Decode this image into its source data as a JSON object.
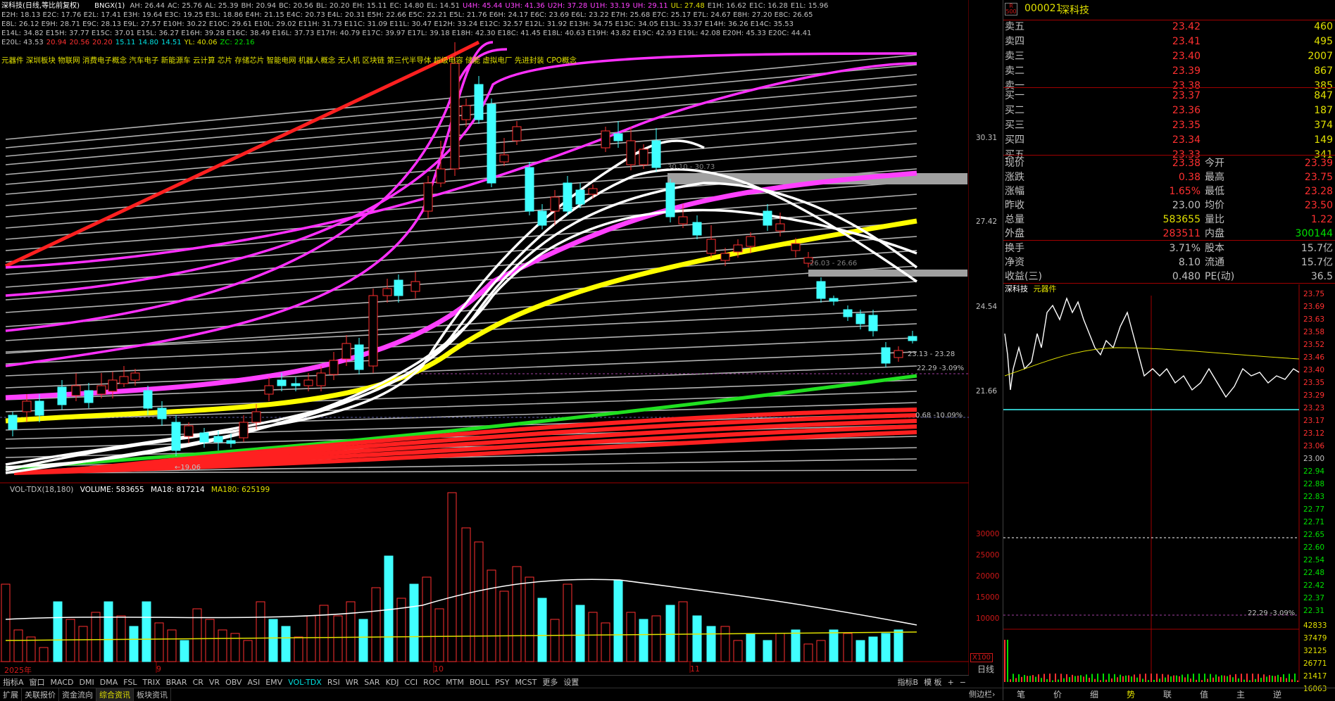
{
  "header": {
    "stock_name": "深科技",
    "chart_mode": "(日线,等比前复权)",
    "indicator_name": "BNGX(1)",
    "indicators_line1": [
      {
        "t": "AH: 26.44",
        "c": "#c0c0c0"
      },
      {
        "t": "AC: 25.76",
        "c": "#c0c0c0"
      },
      {
        "t": "AL: 25.39",
        "c": "#c0c0c0"
      },
      {
        "t": "BH: 20.94",
        "c": "#c0c0c0"
      },
      {
        "t": "BC: 20.56",
        "c": "#c0c0c0"
      },
      {
        "t": "BL: 20.20",
        "c": "#c0c0c0"
      },
      {
        "t": "EH: 15.11",
        "c": "#c0c0c0"
      },
      {
        "t": "EC: 14.80",
        "c": "#c0c0c0"
      },
      {
        "t": "EL: 14.51",
        "c": "#c0c0c0"
      },
      {
        "t": "U4H: 45.44",
        "c": "#ff40ff"
      },
      {
        "t": "U3H: 41.36",
        "c": "#ff40ff"
      },
      {
        "t": "U2H: 37.28",
        "c": "#ff40ff"
      },
      {
        "t": "U1H: 33.19",
        "c": "#ff40ff"
      },
      {
        "t": "UH: 29.11",
        "c": "#ff40ff"
      },
      {
        "t": "UL: 27.48",
        "c": "#e0e000"
      },
      {
        "t": "E1H: 16.62",
        "c": "#c0c0c0"
      },
      {
        "t": "E1C: 16.28",
        "c": "#c0c0c0"
      },
      {
        "t": "E1L: 15.96",
        "c": "#c0c0c0"
      }
    ],
    "indicators_line2": "E2H: 18.13 E2C: 17.76 E2L: 17.41 E3H: 19.64 E3C: 19.25 E3L: 18.86 E4H: 21.15 E4C: 20.73 E4L: 20.31 E5H: 22.66 E5C: 22.21 E5L: 21.76 E6H: 24.17 E6C: 23.69 E6L: 23.22 E7H: 25.68 E7C: 25.17 E7L: 24.67 E8H: 27.20 E8C: 26.65",
    "indicators_line3": "E8L: 26.12 E9H: 28.71 E9C: 28.13 E9L: 27.57 E10H: 30.22 E10C: 29.61 E10L: 29.02 E11H: 31.73 E11C: 31.09 E11L: 30.47 E12H: 33.24 E12C: 32.57 E12L: 31.92 E13H: 34.75 E13C: 34.05 E13L: 33.37 E14H: 36.26 E14C: 35.53",
    "indicators_line4": "E14L: 34.82 E15H: 37.77 E15C: 37.01 E15L: 36.27 E16H: 39.28 E16C: 38.49 E16L: 37.73 E17H: 40.79 E17C: 39.97 E17L: 39.18 E18H: 42.30 E18C: 41.45 E18L: 40.63 E19H: 43.82 E19C: 42.93 E19L: 42.08 E20H: 45.33 E20C: 44.41",
    "indicators_line5": [
      {
        "t": "E20L: 43.53",
        "c": "#c0c0c0"
      },
      {
        "t": "20.94",
        "c": "#ff3030"
      },
      {
        "t": "20.56",
        "c": "#ff3030"
      },
      {
        "t": "20.20",
        "c": "#ff3030"
      },
      {
        "t": "15.11",
        "c": "#00e0e0"
      },
      {
        "t": "14.80",
        "c": "#00e0e0"
      },
      {
        "t": "14.51",
        "c": "#00e0e0"
      },
      {
        "t": "YL: 40.06",
        "c": "#e0e000"
      },
      {
        "t": "ZC: 22.16",
        "c": "#00e000"
      }
    ],
    "sectors": "元器件 深圳板块 物联网 消费电子概念 汽车电子 新能源车 云计算 芯片 存储芯片 智能电网 机器人概念 无人机 区块链 第三代半导体 超级电容 储能 虚拟电厂 先进封装 CPO概念"
  },
  "main_chart": {
    "y_ticks": [
      "30.31",
      "27.42",
      "24.54",
      "21.66"
    ],
    "annotations": [
      {
        "t": "30.10 - 30.73",
        "c": "#808080"
      },
      {
        "t": "26.03 - 26.66",
        "c": "#808080"
      },
      {
        "t": "23.13 - 23.28",
        "c": "#c0c0c0"
      },
      {
        "t": "22.29 -3.09%",
        "c": "#c0c0c0"
      },
      {
        "t": "0.68 -10.09%",
        "c": "#c0c0c0"
      },
      {
        "t": "←19.06",
        "c": "#c0c0c0"
      }
    ]
  },
  "volume": {
    "title": "VOL-TDX(18,180)",
    "volume_label": "VOLUME: 583655",
    "ma18_label": "MA18: 817214",
    "ma180_label": "MA180: 625199",
    "y_ticks": [
      "30000",
      "25000",
      "20000",
      "15000",
      "10000"
    ],
    "unit": "X100",
    "dates": [
      "2025年",
      "9",
      "10",
      "11"
    ]
  },
  "toolbar": [
    "指标A",
    "窗口",
    "MACD",
    "DMI",
    "DMA",
    "FSL",
    "TRIX",
    "BRAR",
    "CR",
    "VR",
    "OBV",
    "ASI",
    "EMV",
    "VOL-TDX",
    "RSI",
    "WR",
    "SAR",
    "KDJ",
    "CCI",
    "ROC",
    "MTM",
    "BOLL",
    "PSY",
    "MCST",
    "更多",
    "设置"
  ],
  "toolbar_right": [
    "指标B",
    "模 板",
    "+",
    "−"
  ],
  "bottombar": [
    "扩展",
    "关联报价",
    "资金流向",
    "综合资讯",
    "板块资讯"
  ],
  "bottombar_right": "侧边栏",
  "quote": {
    "code": "000021",
    "name": "深科技",
    "asks": [
      {
        "label": "卖五",
        "price": "23.42",
        "vol": "460"
      },
      {
        "label": "卖四",
        "price": "23.41",
        "vol": "495"
      },
      {
        "label": "卖三",
        "price": "23.40",
        "vol": "2007"
      },
      {
        "label": "卖二",
        "price": "23.39",
        "vol": "867"
      },
      {
        "label": "卖一",
        "price": "23.38",
        "vol": "385"
      }
    ],
    "bids": [
      {
        "label": "买一",
        "price": "23.37",
        "vol": "847"
      },
      {
        "label": "买二",
        "price": "23.36",
        "vol": "187"
      },
      {
        "label": "买三",
        "price": "23.35",
        "vol": "374"
      },
      {
        "label": "买四",
        "price": "23.34",
        "vol": "149"
      },
      {
        "label": "买五",
        "price": "23.33",
        "vol": "341"
      }
    ],
    "stats": [
      {
        "l1": "现价",
        "v1": "23.38",
        "c1": "up",
        "l2": "今开",
        "v2": "23.39",
        "c2": "up"
      },
      {
        "l1": "涨跌",
        "v1": "0.38",
        "c1": "up",
        "l2": "最高",
        "v2": "23.75",
        "c2": "up"
      },
      {
        "l1": "涨幅",
        "v1": "1.65%",
        "c1": "up",
        "l2": "最低",
        "v2": "23.28",
        "c2": "up"
      },
      {
        "l1": "昨收",
        "v1": "23.00",
        "c1": "w",
        "l2": "均价",
        "v2": "23.50",
        "c2": "up"
      },
      {
        "l1": "总量",
        "v1": "583655",
        "c1": "yel",
        "l2": "量比",
        "v2": "1.22",
        "c2": "up"
      },
      {
        "l1": "外盘",
        "v1": "283511",
        "c1": "up",
        "l2": "内盘",
        "v2": "300144",
        "c2": "dn"
      }
    ],
    "stats2": [
      {
        "l1": "换手",
        "v1": "3.71%",
        "l2": "股本",
        "v2": "15.7亿"
      },
      {
        "l1": "净资",
        "v1": "8.10",
        "l2": "流通",
        "v2": "15.7亿"
      },
      {
        "l1": "收益(三)",
        "v1": "0.480",
        "l2": "PE(动)",
        "v2": "36.5"
      }
    ]
  },
  "minichart": {
    "name": "深科技",
    "sector": "元器件",
    "price_ticks": [
      "23.75",
      "23.69",
      "23.63",
      "23.58",
      "23.52",
      "23.46",
      "23.40",
      "23.35",
      "23.29",
      "23.23",
      "23.17",
      "23.12",
      "23.06",
      "23.00",
      "22.94",
      "22.88",
      "22.83",
      "22.77",
      "22.71",
      "22.65",
      "22.60",
      "22.54",
      "22.48",
      "22.42",
      "22.37",
      "22.31"
    ],
    "vol_ticks": [
      "42833",
      "37479",
      "32125",
      "26771",
      "21417",
      "16063"
    ],
    "ref_label": "22.29 -3.09%",
    "tabs": [
      "笔",
      "价",
      "细",
      "势",
      "联",
      "值",
      "主",
      "逆"
    ],
    "active_tab": "势"
  }
}
